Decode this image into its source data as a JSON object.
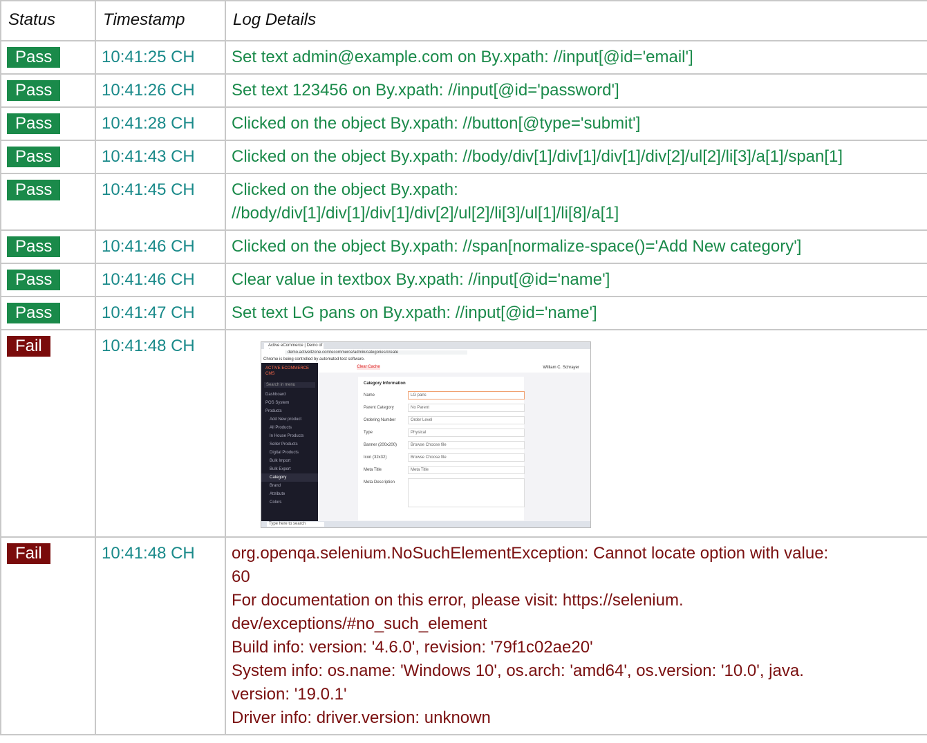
{
  "headers": {
    "status": "Status",
    "timestamp": "Timestamp",
    "details": "Log Details"
  },
  "rows": [
    {
      "status": "Pass",
      "time": "10:41:25 CH",
      "lines": [
        "Set text admin@example.com on By.xpath: //input[@id='email']"
      ]
    },
    {
      "status": "Pass",
      "time": "10:41:26 CH",
      "lines": [
        "Set text 123456 on By.xpath: //input[@id='password']"
      ]
    },
    {
      "status": "Pass",
      "time": "10:41:28 CH",
      "lines": [
        "Clicked on the object By.xpath: //button[@type='submit']"
      ]
    },
    {
      "status": "Pass",
      "time": "10:41:43 CH",
      "lines": [
        "Clicked on the object By.xpath: //body/div[1]/div[1]/div[1]/div[2]/ul[2]/li[3]/a[1]/span[1]"
      ]
    },
    {
      "status": "Pass",
      "time": "10:41:45 CH",
      "lines": [
        "Clicked on the object By.xpath:",
        "//body/div[1]/div[1]/div[1]/div[2]/ul[2]/li[3]/ul[1]/li[8]/a[1]"
      ]
    },
    {
      "status": "Pass",
      "time": "10:41:46 CH",
      "lines": [
        "Clicked on the object By.xpath: //span[normalize-space()='Add New category']"
      ]
    },
    {
      "status": "Pass",
      "time": "10:41:46 CH",
      "lines": [
        "Clear value in textbox By.xpath: //input[@id='name']"
      ]
    },
    {
      "status": "Pass",
      "time": "10:41:47 CH",
      "lines": [
        "Set text LG pans on By.xpath: //input[@id='name']"
      ]
    }
  ],
  "fail_screenshot_row": {
    "status": "Fail",
    "time": "10:41:48 CH",
    "screenshot": {
      "tab": "Active eCommerce | Demo of A",
      "url": "demo.activeitzone.com/ecommerce/admin/categories/create",
      "infobar": "Chrome is being controlled by automated test software.",
      "logo": "ACTIVE ECOMMERCE CMS",
      "search": "Search in menu",
      "menu": [
        "Dashboard",
        "POS System",
        "Products",
        "Add New product",
        "All Products",
        "In House Products",
        "Seller Products",
        "Digital Products",
        "Bulk Import",
        "Bulk Export",
        "Category",
        "Brand",
        "Attribute",
        "Colors"
      ],
      "clear_cache": "Clear Cache",
      "user": "William C. Schrayer",
      "card_title": "Category Information",
      "fields": [
        {
          "label": "Name",
          "value": "LG pans"
        },
        {
          "label": "Parent Category",
          "value": "No Parent"
        },
        {
          "label": "Ordering Number",
          "value": "Order Level"
        },
        {
          "label": "Type",
          "value": "Physical"
        },
        {
          "label": "Banner (200x200)",
          "value": "Browse   Choose file"
        },
        {
          "label": "Icon (32x32)",
          "value": "Browse   Choose file"
        },
        {
          "label": "Meta Title",
          "value": "Meta Title"
        },
        {
          "label": "Meta Description",
          "value": ""
        }
      ],
      "taskbar_search": "Type here to search"
    }
  },
  "fail_error_row": {
    "status": "Fail",
    "time": "10:41:48 CH",
    "lines": [
      "org.openqa.selenium.NoSuchElementException: Cannot locate option with value:",
      "60",
      "For documentation on this error, please visit: https://selenium.",
      "dev/exceptions/#no_such_element",
      "Build info: version: '4.6.0', revision: '79f1c02ae20'",
      "System info: os.name: 'Windows 10', os.arch: 'amd64', os.version: '10.0', java.",
      "version: '19.0.1'",
      "Driver info: driver.version: unknown"
    ]
  },
  "colors": {
    "pass": "#1a8a4a",
    "fail": "#7a0b0b",
    "timestamp": "#1a8a8a"
  }
}
